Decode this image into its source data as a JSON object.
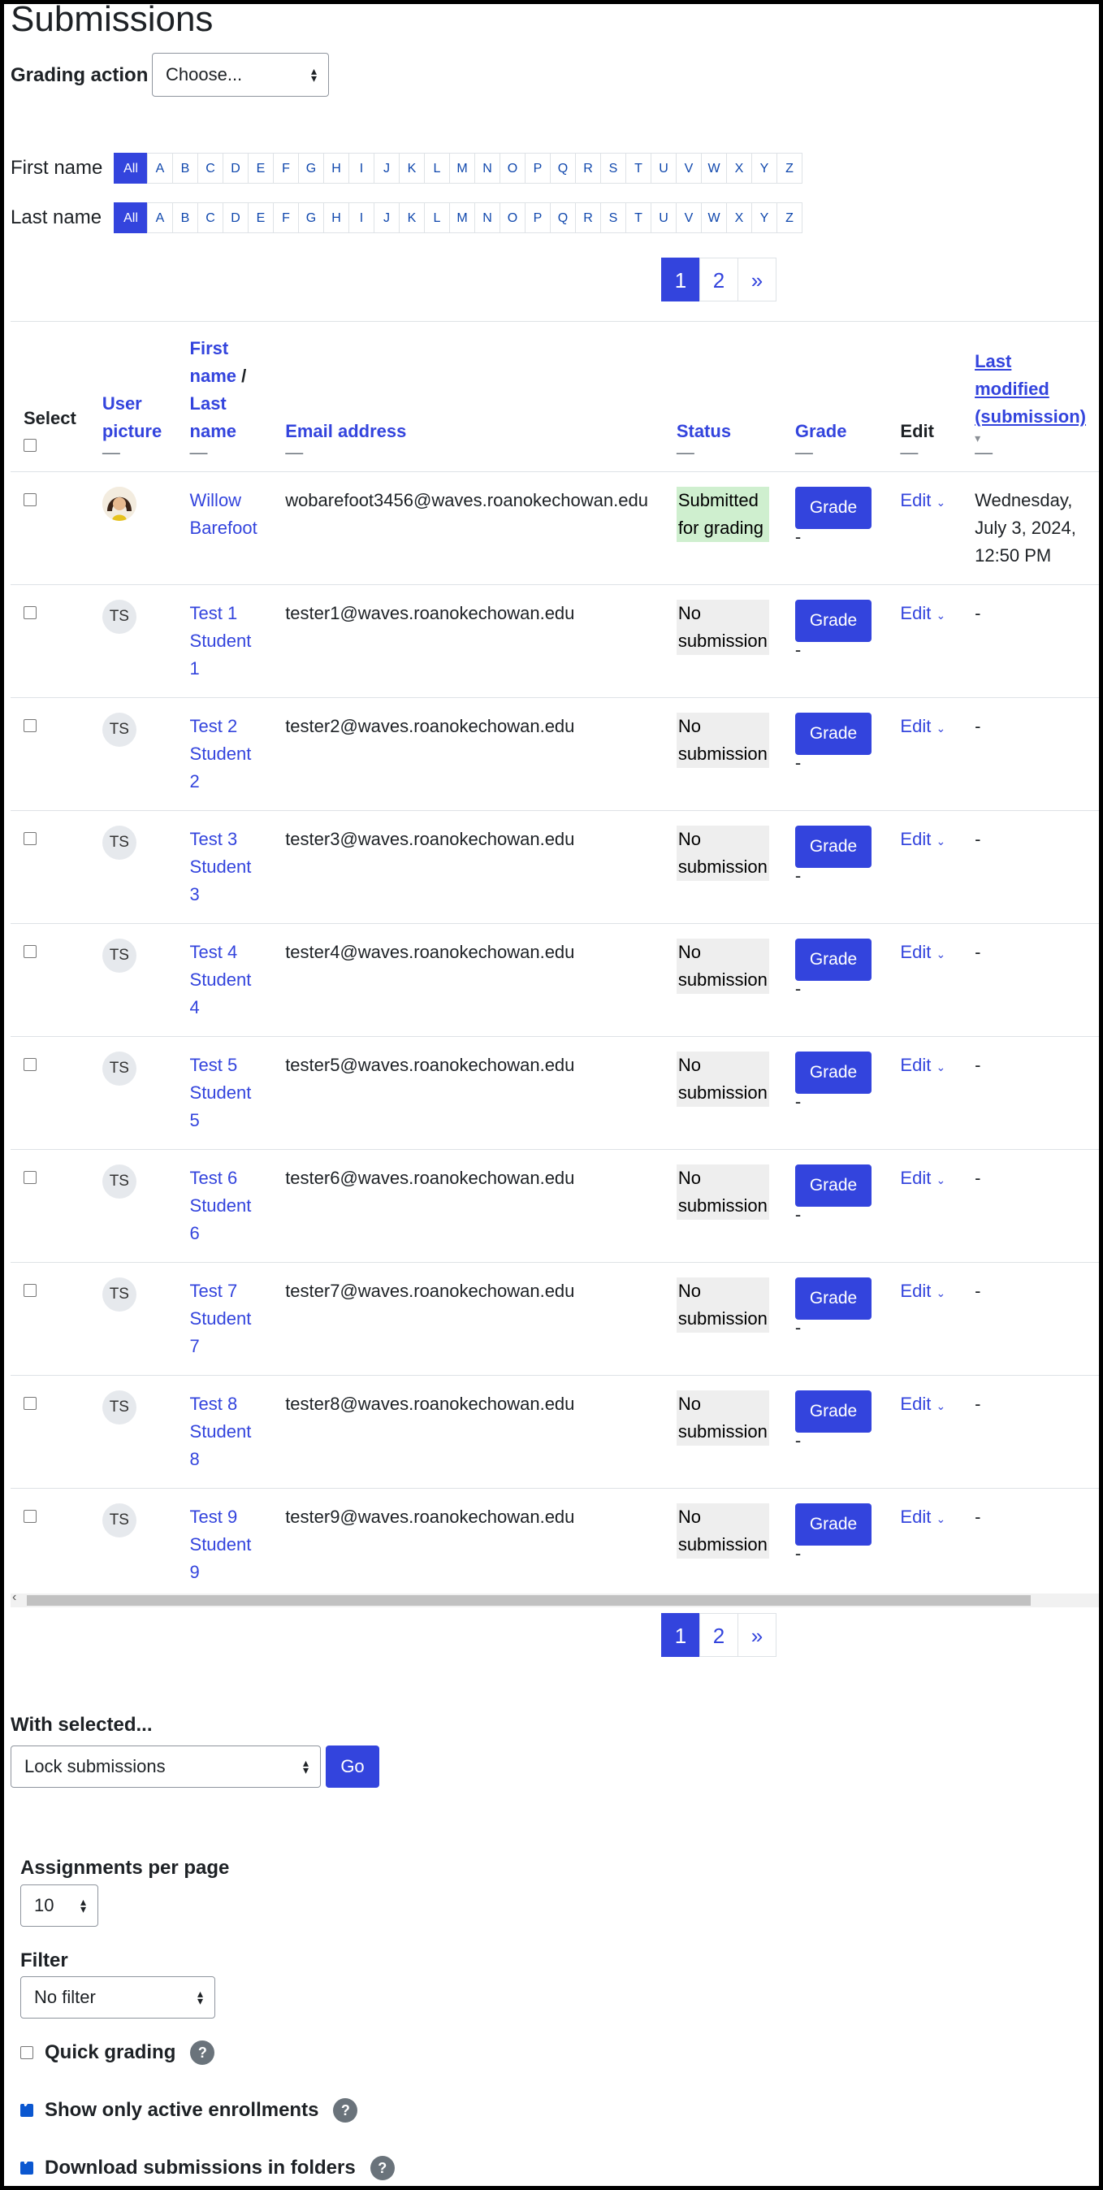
{
  "title": "Submissions",
  "grading_action": {
    "label": "Grading action",
    "value": "Choose..."
  },
  "initials_bar": {
    "first_name_label": "First name",
    "last_name_label": "Last name",
    "letters": [
      "All",
      "A",
      "B",
      "C",
      "D",
      "E",
      "F",
      "G",
      "H",
      "I",
      "J",
      "K",
      "L",
      "M",
      "N",
      "O",
      "P",
      "Q",
      "R",
      "S",
      "T",
      "U",
      "V",
      "W",
      "X",
      "Y",
      "Z"
    ]
  },
  "pagination": {
    "pages": [
      "1",
      "2"
    ],
    "next": "»",
    "current": "1"
  },
  "table": {
    "headers": {
      "select": "Select",
      "user_picture": "User picture",
      "first_name": "First name",
      "slash": " / ",
      "last_name": "Last name",
      "email": "Email address",
      "status": "Status",
      "grade": "Grade",
      "edit": "Edit",
      "last_modified": "Last modified (submission)",
      "dash": "—"
    },
    "rows": [
      {
        "avatar": "photo",
        "name": "Willow Barefoot",
        "email": "wobarefoot3456@waves.roanokechowan.edu",
        "status": "Submitted for grading",
        "status_type": "submitted",
        "grade_btn": "Grade",
        "grade_value": "-",
        "edit": "Edit",
        "modified": "Wednesday, July 3, 2024, 12:50 PM"
      },
      {
        "avatar": "TS",
        "name": "Test 1 Student 1",
        "email": "tester1@waves.roanokechowan.edu",
        "status": "No submission",
        "status_type": "none",
        "grade_btn": "Grade",
        "grade_value": "-",
        "edit": "Edit",
        "modified": "-"
      },
      {
        "avatar": "TS",
        "name": "Test 2 Student 2",
        "email": "tester2@waves.roanokechowan.edu",
        "status": "No submission",
        "status_type": "none",
        "grade_btn": "Grade",
        "grade_value": "-",
        "edit": "Edit",
        "modified": "-"
      },
      {
        "avatar": "TS",
        "name": "Test 3 Student 3",
        "email": "tester3@waves.roanokechowan.edu",
        "status": "No submission",
        "status_type": "none",
        "grade_btn": "Grade",
        "grade_value": "-",
        "edit": "Edit",
        "modified": "-"
      },
      {
        "avatar": "TS",
        "name": "Test 4 Student 4",
        "email": "tester4@waves.roanokechowan.edu",
        "status": "No submission",
        "status_type": "none",
        "grade_btn": "Grade",
        "grade_value": "-",
        "edit": "Edit",
        "modified": "-"
      },
      {
        "avatar": "TS",
        "name": "Test 5 Student 5",
        "email": "tester5@waves.roanokechowan.edu",
        "status": "No submission",
        "status_type": "none",
        "grade_btn": "Grade",
        "grade_value": "-",
        "edit": "Edit",
        "modified": "-"
      },
      {
        "avatar": "TS",
        "name": "Test 6 Student 6",
        "email": "tester6@waves.roanokechowan.edu",
        "status": "No submission",
        "status_type": "none",
        "grade_btn": "Grade",
        "grade_value": "-",
        "edit": "Edit",
        "modified": "-"
      },
      {
        "avatar": "TS",
        "name": "Test 7 Student 7",
        "email": "tester7@waves.roanokechowan.edu",
        "status": "No submission",
        "status_type": "none",
        "grade_btn": "Grade",
        "grade_value": "-",
        "edit": "Edit",
        "modified": "-"
      },
      {
        "avatar": "TS",
        "name": "Test 8 Student 8",
        "email": "tester8@waves.roanokechowan.edu",
        "status": "No submission",
        "status_type": "none",
        "grade_btn": "Grade",
        "grade_value": "-",
        "edit": "Edit",
        "modified": "-"
      },
      {
        "avatar": "TS",
        "name": "Test 9 Student 9",
        "email": "tester9@waves.roanokechowan.edu",
        "status": "No submission",
        "status_type": "none",
        "grade_btn": "Grade",
        "grade_value": "-",
        "edit": "Edit",
        "modified": "-"
      }
    ]
  },
  "bulk": {
    "label": "With selected...",
    "value": "Lock submissions",
    "go": "Go"
  },
  "options": {
    "per_page_label": "Assignments per page",
    "per_page_value": "10",
    "filter_label": "Filter",
    "filter_value": "No filter",
    "quick_grading": "Quick grading",
    "active_only": "Show only active enrollments",
    "download_folders": "Download submissions in folders",
    "help": "?"
  },
  "colors": {
    "primary": "#3344dd",
    "submitted_bg": "#cfefcf",
    "none_bg": "#eeeeee"
  }
}
